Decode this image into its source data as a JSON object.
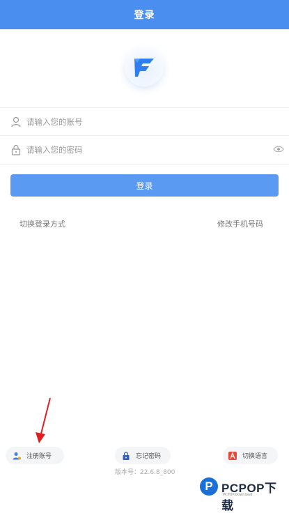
{
  "header": {
    "title": "登录"
  },
  "form": {
    "account_placeholder": "请输入您的账号",
    "password_placeholder": "请输入您的密码",
    "login_label": "登录"
  },
  "links": {
    "switch_login": "切换登录方式",
    "change_phone": "修改手机号码"
  },
  "footer": {
    "register": "注册账号",
    "forgot_password": "忘记密码",
    "switch_language": "切换语言",
    "version": "版本号：22.6.8_800"
  },
  "watermark": {
    "name": "PCPOP下载",
    "sub": "PCPOP.Download"
  },
  "colors": {
    "header": "#4a8ef0",
    "button": "#5b9af2",
    "arrow": "#e02020"
  }
}
